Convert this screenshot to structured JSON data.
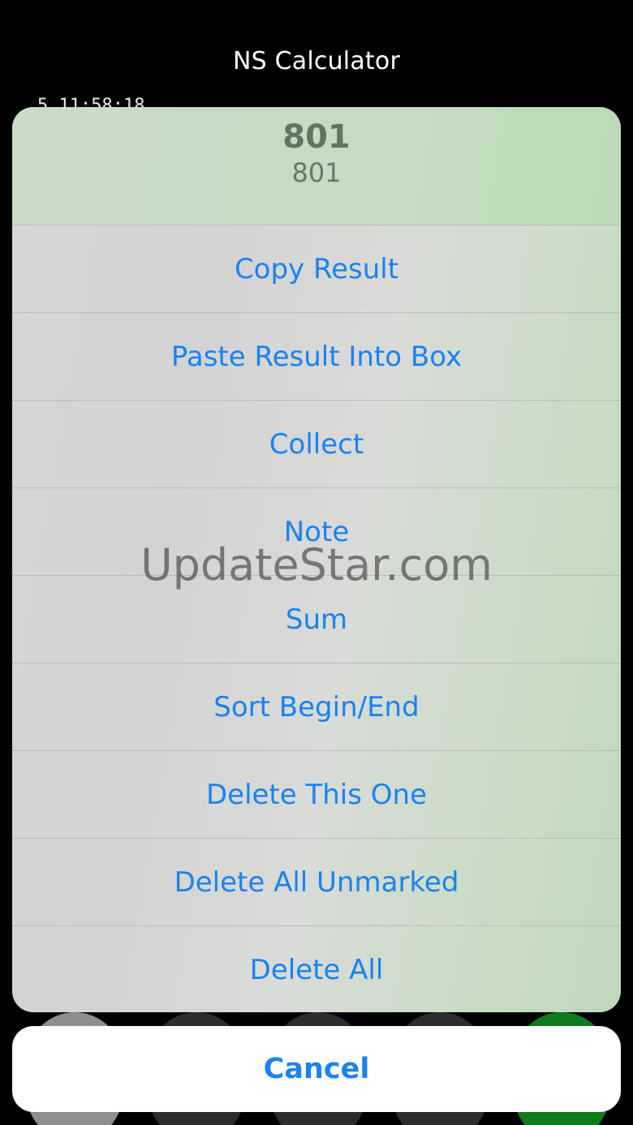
{
  "app": {
    "title": "NS Calculator"
  },
  "background": {
    "timestamp": "5 11:58:18"
  },
  "action_sheet": {
    "header": {
      "result": "801",
      "expression": "801"
    },
    "items": [
      {
        "label": "Copy Result"
      },
      {
        "label": "Paste Result Into Box"
      },
      {
        "label": "Collect"
      },
      {
        "label": "Note"
      },
      {
        "label": "Sum"
      },
      {
        "label": "Sort Begin/End"
      },
      {
        "label": "Delete This One"
      },
      {
        "label": "Delete All Unmarked"
      },
      {
        "label": "Delete All"
      }
    ],
    "cancel_label": "Cancel"
  },
  "watermark": {
    "text": "UpdateStar.com"
  },
  "colors": {
    "accent": "#1a82f0",
    "header_text": "#5f755e",
    "background": "#000000"
  }
}
